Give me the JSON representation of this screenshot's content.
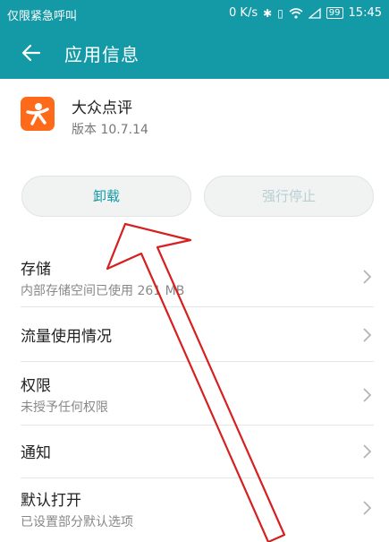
{
  "status_bar": {
    "carrier": "仅限紧急呼叫",
    "network_speed": "0 K/s",
    "battery_level": "99",
    "time": "15:45",
    "icons": [
      "bluetooth-icon",
      "vibrate-icon",
      "wifi-icon",
      "signal-icon",
      "battery-icon"
    ]
  },
  "app_bar": {
    "title": "应用信息",
    "back_icon": "back-arrow-icon",
    "background": "#139aa6"
  },
  "app": {
    "name": "大众点评",
    "version": "版本 10.7.14",
    "icon_color": "#ff6a1a"
  },
  "buttons": {
    "uninstall": "卸载",
    "force_stop": "强行停止"
  },
  "settings": [
    {
      "title": "存储",
      "subtitle": "内部存储空间已使用 261 MB"
    },
    {
      "title": "流量使用情况",
      "subtitle": ""
    },
    {
      "title": "权限",
      "subtitle": "未授予任何权限"
    },
    {
      "title": "通知",
      "subtitle": ""
    },
    {
      "title": "默认打开",
      "subtitle": "已设置部分默认选项"
    }
  ],
  "annotation": {
    "color": "#d62020"
  }
}
